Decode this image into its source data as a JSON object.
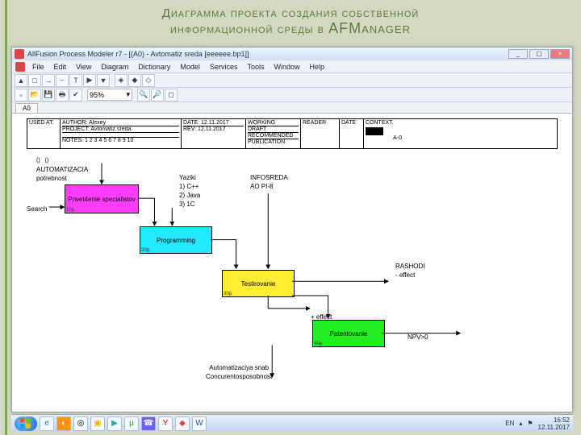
{
  "slide": {
    "title_line1": "Диаграмма проекта создания собственной",
    "title_line2": "информационной среды   в ",
    "title_line2_big": "AFManager"
  },
  "window": {
    "title": "AllFusion Process Modeler r7 - [(A0)  - Avtomatiz sreda    [eeeeee.bp1]]",
    "menus": [
      "File",
      "Edit",
      "View",
      "Diagram",
      "Dictionary",
      "Model",
      "Services",
      "Tools",
      "Window",
      "Help"
    ],
    "zoom": "95%",
    "tab": "A0"
  },
  "idef": {
    "used_at": "USED AT:",
    "author": "AUTHOR: Alexey",
    "project": "PROJECT: Avtomatiz sreda",
    "notes": "NOTES:  1  2  3  4  5  6  7  8  9  10",
    "date": "DATE: 12.11.2017",
    "rev": "REV:  12.11.2017",
    "working": "WORKING",
    "draft": "DRAFT",
    "recommended": "RECOMMENDED",
    "publication": "PUBLICATION",
    "reader": "READER",
    "date_col": "DATE",
    "context": "CONTEXT.",
    "a0": "A-0"
  },
  "labels": {
    "automatizacia": "AUTOMATIZACIA",
    "potrebnost": "potrebnost",
    "search": "Search",
    "yaziki": "Yaziki\n1) C++\n2) Java\n3) 1C",
    "infosreda": "INFOSREDA\nAO PI-8",
    "rashodi": "RASHODI\n- effect",
    "plus_effect": "+ effect",
    "npv": "NPV>0",
    "bottom": "Automatizaciya snab\nConcurentosposobnost",
    "tunnel": "()   ()"
  },
  "boxes": {
    "a": "Privet4enie\nspecialistov",
    "b": "Programming",
    "c": "Testirovanie",
    "d": "Patentovanie"
  },
  "taskbar": {
    "lang": "EN",
    "time": "16:52",
    "date": "12.11.2017"
  }
}
